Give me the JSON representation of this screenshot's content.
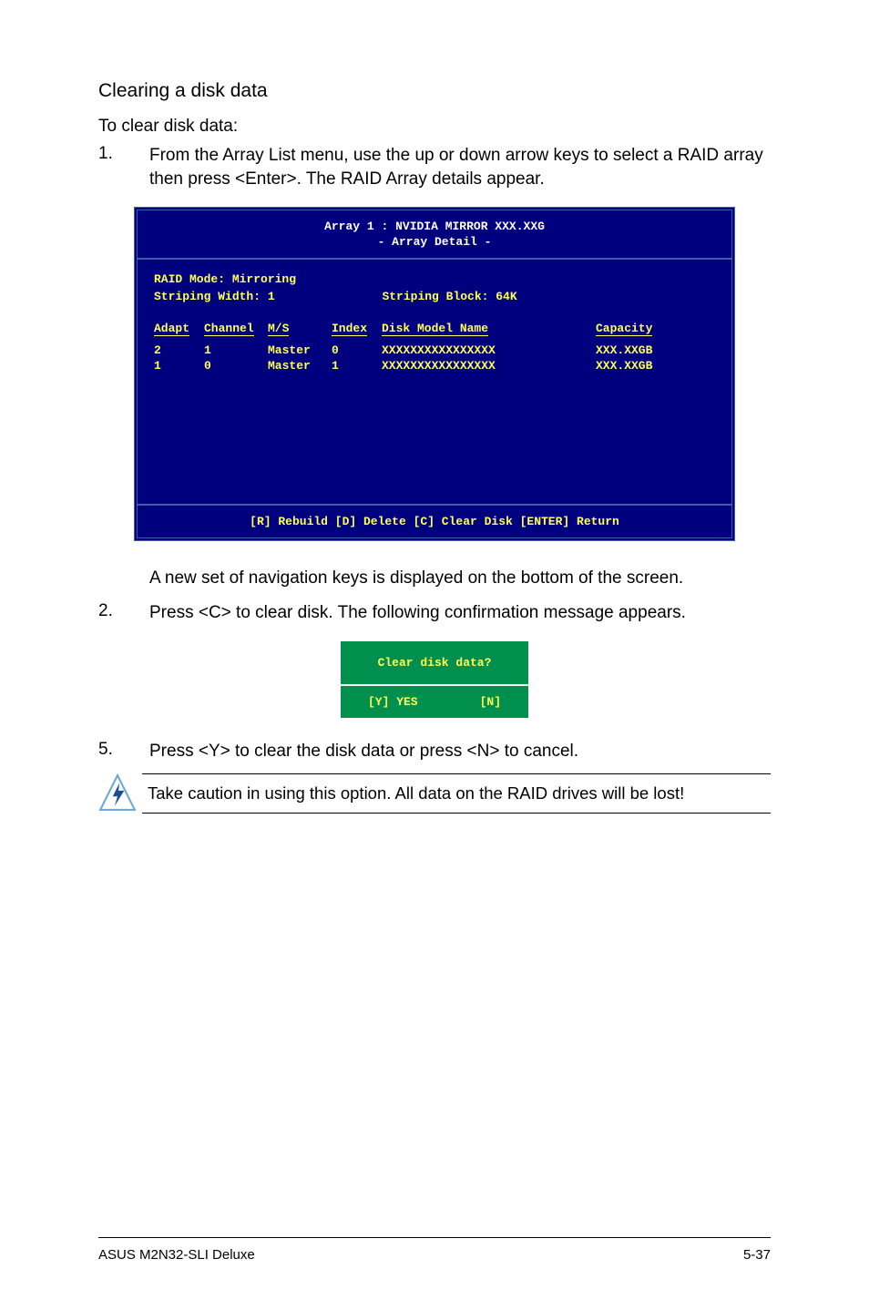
{
  "section_title": "Clearing a disk data",
  "lead": "To clear disk data:",
  "step1_num": "1.",
  "step1_text": "From the Array List menu, use the up or down arrow keys to select a RAID array then press <Enter>. The RAID Array details appear.",
  "bios": {
    "header_line1": "Array 1 : NVIDIA MIRROR  XXX.XXG",
    "header_line2": "- Array Detail -",
    "mode_label": "RAID Mode: Mirroring",
    "width_label": "Striping Width: 1",
    "block_label": "Striping Block: 64K",
    "headers": {
      "adapt": "Adapt",
      "channel": "Channel",
      "ms": "M/S",
      "index": "Index",
      "model": "Disk Model Name",
      "capacity": "Capacity"
    },
    "rows": [
      {
        "adapt": "2",
        "channel": "1",
        "ms": "Master",
        "index": "0",
        "model": "XXXXXXXXXXXXXXXX",
        "capacity": "XXX.XXGB"
      },
      {
        "adapt": "1",
        "channel": "0",
        "ms": "Master",
        "index": "1",
        "model": "XXXXXXXXXXXXXXXX",
        "capacity": "XXX.XXGB"
      }
    ],
    "footer": "[R] Rebuild  [D] Delete  [C] Clear Disk  [ENTER] Return"
  },
  "after_bios1": "A new set of  navigation keys is displayed on the bottom of the screen.",
  "step2_num": "2.",
  "step2_text": "Press <C> to clear disk. The following confirmation message appears.",
  "confirm": {
    "question": "Clear disk data?",
    "yes": "[Y] YES",
    "no": "[N]"
  },
  "step5_num": "5.",
  "step5_text": "Press <Y> to clear the disk data or press <N> to cancel.",
  "caution": "Take caution in using this option. All data on the RAID drives will be lost!",
  "footer_left": "ASUS M2N32-SLI Deluxe",
  "footer_right": "5-37"
}
